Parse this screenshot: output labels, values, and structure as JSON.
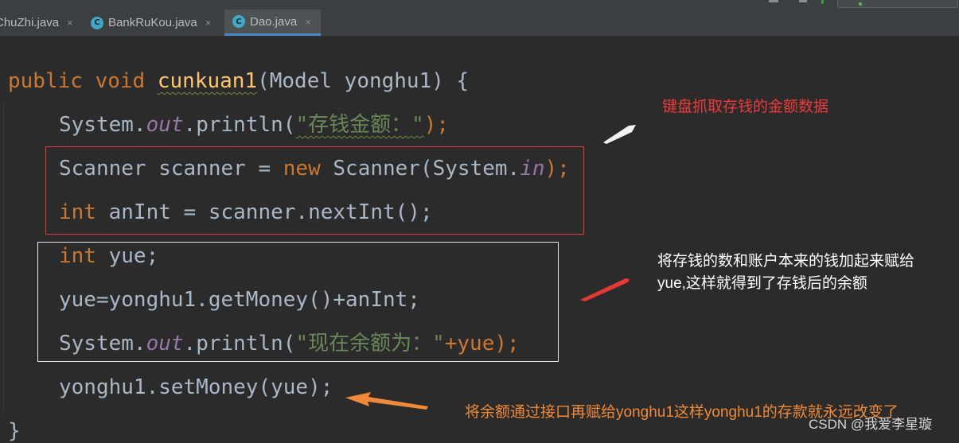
{
  "tabs": [
    {
      "label": "ChuZhi.java",
      "close": "×",
      "icon": "java-class-icon",
      "active": false
    },
    {
      "label": "BankRuKou.java",
      "close": "×",
      "icon": "java-class-run-icon",
      "active": false
    },
    {
      "label": "Dao.java",
      "close": "×",
      "icon": "java-class-icon",
      "active": true
    }
  ],
  "code": {
    "l1": {
      "public": "public",
      "void": "void",
      "method": "cunkuan1",
      "rest": "(Model yonghu1) {"
    },
    "l2": {
      "sys": "System.",
      "out": "out",
      "call": ".println(",
      "str": "\"存钱金额：\"",
      "end": ");"
    },
    "l3": {
      "a": "Scanner scanner = ",
      "new": "new",
      "b": " Scanner(System.",
      "in": "in",
      "c": ");"
    },
    "l4": {
      "int": "int",
      "rest": " anInt = scanner.nextInt();"
    },
    "l5": {
      "int": "int",
      "rest": " yue;"
    },
    "l6": {
      "text": "yue=yonghu1.getMoney()+anInt;"
    },
    "l7": {
      "sys": "System.",
      "out": "out",
      "call": ".println(",
      "str": "\"现在余额为：\"",
      "end": "+yue);"
    },
    "l8": {
      "text": "yonghu1.setMoney(yue);"
    },
    "l9": {
      "text": "}"
    }
  },
  "annotations": {
    "red": "键盘抓取存钱的金额数据",
    "white_line1": "将存钱的数和账户本来的钱加起来赋给",
    "white_line2": "yue,这样就得到了存钱后的余额",
    "orange": "将余额通过接口再赋给yonghu1这样yonghu1的存款就永远改变了"
  },
  "watermark": "CSDN @我爱李星璇",
  "colors": {
    "background": "#2b2b2b",
    "keyword": "#cc7832",
    "method": "#ffc66d",
    "string": "#6a8759",
    "static_field": "#9876aa",
    "annotation_red": "#ee3a3a",
    "annotation_orange": "#f08a3a"
  }
}
